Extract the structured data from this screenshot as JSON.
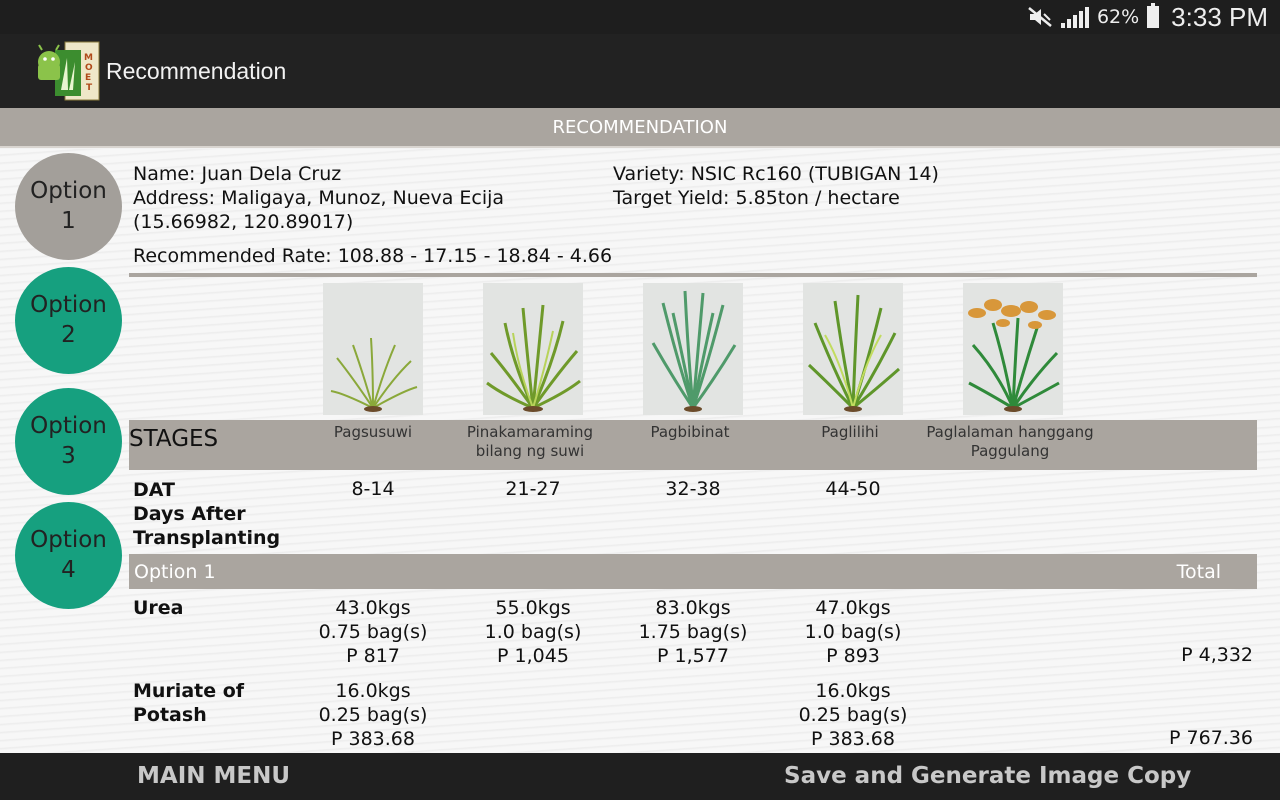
{
  "status_bar": {
    "battery": "62%",
    "time": "3:33 PM",
    "icons": [
      "mute-icon",
      "signal-icon",
      "battery-icon"
    ]
  },
  "app_bar": {
    "title": "Recommendation",
    "logo_text": "MOET"
  },
  "section_title": "RECOMMENDATION",
  "options": [
    {
      "line1": "Option",
      "line2": "1",
      "active": true
    },
    {
      "line1": "Option",
      "line2": "2",
      "active": false
    },
    {
      "line1": "Option",
      "line2": "3",
      "active": false
    },
    {
      "line1": "Option",
      "line2": "4",
      "active": false
    }
  ],
  "farmer": {
    "name": "Name: Juan Dela Cruz",
    "address": "Address: Maligaya, Munoz, Nueva Ecija",
    "coords": "(15.66982, 120.89017)",
    "variety": "Variety:  NSIC Rc160 (TUBIGAN 14)",
    "target_yield": "Target Yield:  5.85ton / hectare",
    "recommended_rate": "Recommended Rate: 108.88 - 17.15 - 18.84 - 4.66"
  },
  "stages": {
    "label": "STAGES",
    "items": [
      {
        "name1": "Pagsusuwi",
        "name2": ""
      },
      {
        "name1": "Pinakamaraming",
        "name2": "bilang ng suwi"
      },
      {
        "name1": "Pagbibinat",
        "name2": ""
      },
      {
        "name1": "Paglilihi",
        "name2": ""
      },
      {
        "name1": "Paglalaman hanggang",
        "name2": "Paggulang"
      }
    ]
  },
  "dat": {
    "label1": "DAT",
    "label2": "Days After",
    "label3": "Transplanting",
    "values": [
      "8-14",
      "21-27",
      "32-38",
      "44-50"
    ]
  },
  "option_table": {
    "label": "Option 1",
    "total_header": "Total",
    "rows": [
      {
        "name1": "Urea",
        "name2": "",
        "cells": [
          {
            "kgs": "43.0kgs",
            "bags": "0.75 bag(s)",
            "price": "P 817"
          },
          {
            "kgs": "55.0kgs",
            "bags": "1.0 bag(s)",
            "price": "P 1,045"
          },
          {
            "kgs": "83.0kgs",
            "bags": "1.75 bag(s)",
            "price": "P 1,577"
          },
          {
            "kgs": "47.0kgs",
            "bags": "1.0 bag(s)",
            "price": "P 893"
          }
        ],
        "total": "P 4,332"
      },
      {
        "name1": "Muriate of",
        "name2": "Potash",
        "cells": [
          {
            "kgs": "16.0kgs",
            "bags": "0.25 bag(s)",
            "price": "P 383.68"
          },
          {
            "kgs": "",
            "bags": "",
            "price": ""
          },
          {
            "kgs": "",
            "bags": "",
            "price": ""
          },
          {
            "kgs": "16.0kgs",
            "bags": "0.25 bag(s)",
            "price": "P 383.68"
          }
        ],
        "total": "P 767.36"
      }
    ]
  },
  "bottom_bar": {
    "main_menu": "MAIN MENU",
    "save": "Save and Generate Image Copy"
  }
}
